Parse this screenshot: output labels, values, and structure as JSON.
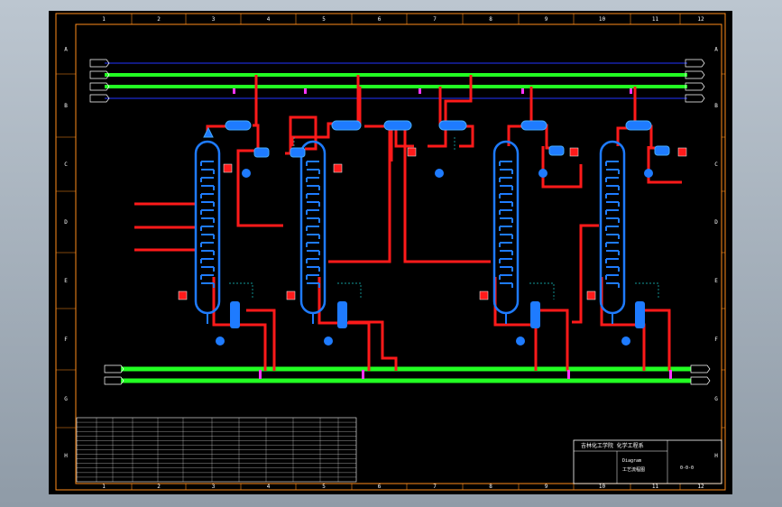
{
  "sheet": {
    "columns": [
      "1",
      "2",
      "3",
      "4",
      "5",
      "6",
      "7",
      "8",
      "9",
      "10",
      "11",
      "12"
    ],
    "rows": [
      "A",
      "B",
      "C",
      "D",
      "E",
      "F",
      "G",
      "H"
    ]
  },
  "colors": {
    "frame": "#ff8c1a",
    "vessel": "#1e7bff",
    "process": "#ff1a1a",
    "utility": "#22ff22",
    "spool": "#ff33ff",
    "instrument": "#19c9c9"
  },
  "title_block": {
    "heading": "吉林化工学院 化学工程系",
    "drawing_name": "Diagram",
    "drawing_sub": "工艺流程图",
    "number": "0-0-0"
  }
}
